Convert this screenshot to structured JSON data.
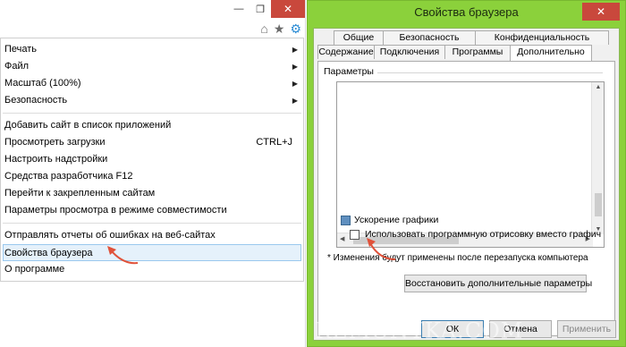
{
  "ie": {
    "window_controls": [
      "minimize-icon",
      "restore-icon",
      "close-icon"
    ],
    "toolbar_icons": [
      "home-icon",
      "star-icon",
      "gear-icon"
    ],
    "menu": {
      "print": "Печать",
      "file": "Файл",
      "zoom": "Масштаб (100%)",
      "security": "Безопасность",
      "add_site": "Добавить сайт в список приложений",
      "downloads": "Просмотреть загрузки",
      "downloads_shortcut": "CTRL+J",
      "addons": "Настроить надстройки",
      "devtools": "Средства разработчика F12",
      "pinned": "Перейти к закрепленным сайтам",
      "compat": "Параметры просмотра в режиме совместимости",
      "report": "Отправлять отчеты об ошибках на веб-сайтах",
      "browser_props": "Свойства браузера",
      "about": "О программе"
    }
  },
  "dialog": {
    "title": "Свойства браузера",
    "tabs_row1": [
      "Общие",
      "Безопасность",
      "Конфиденциальность"
    ],
    "tabs_row2": [
      "Содержание",
      "Подключения",
      "Программы",
      "Дополнительно"
    ],
    "active_tab": "Дополнительно",
    "group_label": "Параметры",
    "category": "Ускорение графики",
    "option": "Использовать программную отрисовку вместо графич",
    "option_checked": false,
    "note": "* Изменения будут применены после перезапуска компьютера",
    "restore_button": "Восстановить дополнительные параметры",
    "ok": "ОК",
    "cancel": "Отмена",
    "apply": "Применить"
  },
  "watermark": "REMONTKA.COM",
  "colors": {
    "dialog_frame": "#8bd13b",
    "close_button": "#c9483c",
    "highlight_bg": "#e5f1fb",
    "arrow": "#e0523a"
  }
}
